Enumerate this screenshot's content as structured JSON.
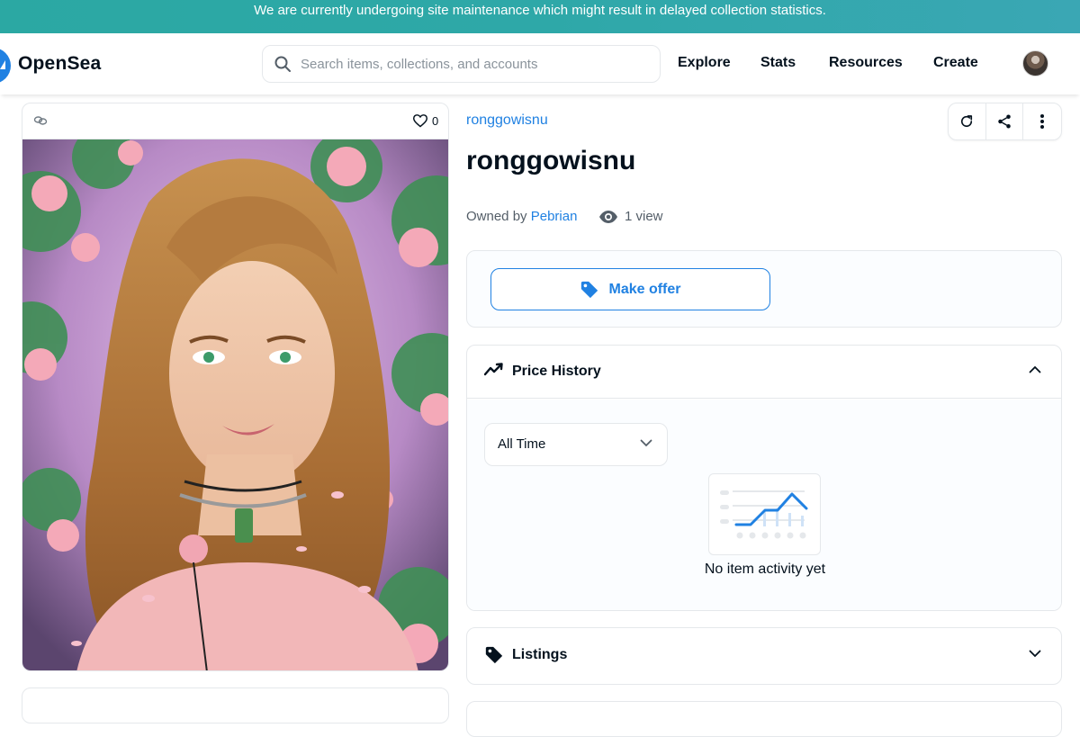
{
  "banner": {
    "text": "We are currently undergoing site maintenance which might result in delayed collection statistics."
  },
  "header": {
    "logo_text": "OpenSea",
    "search_placeholder": "Search items, collections, and accounts",
    "nav": [
      "Explore",
      "Stats",
      "Resources",
      "Create"
    ]
  },
  "item": {
    "favorites": "0",
    "collection": "ronggowisnu",
    "title": "ronggowisnu",
    "owned_by_label": "Owned by",
    "owner": "Pebrian",
    "views": "1 view"
  },
  "offer": {
    "button_label": "Make offer"
  },
  "price_history": {
    "title": "Price History",
    "range_selected": "All Time",
    "empty_text": "No item activity yet"
  },
  "listings": {
    "title": "Listings"
  },
  "colors": {
    "accent": "#2081e2",
    "text": "#04111d",
    "muted": "#545e68",
    "border": "#e5e8eb",
    "banner": "#2ea8a8"
  }
}
